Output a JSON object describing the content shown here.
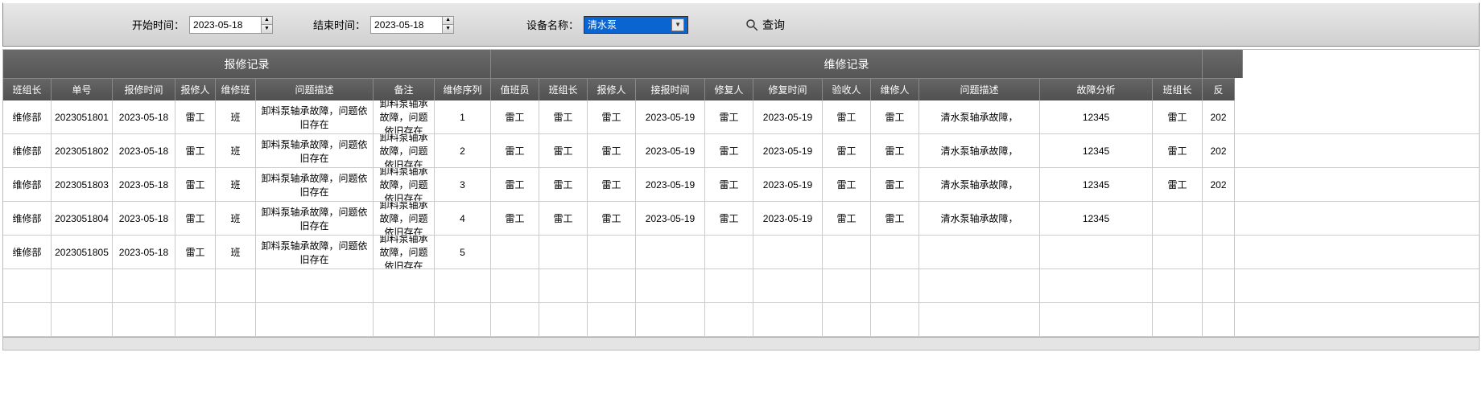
{
  "toolbar": {
    "start_label": "开始时间：",
    "start_date": "2023-05-18",
    "end_label": "结束时间：",
    "end_date": "2023-05-18",
    "device_label": "设备名称：",
    "device_value": "清水泵",
    "search_label": "查询"
  },
  "group_headers": {
    "left": "报修记录",
    "right": "维修记录"
  },
  "columns": [
    "班组长",
    "单号",
    "报修时间",
    "报修人",
    "维修班",
    "问题描述",
    "备注",
    "维修序列",
    "值班员",
    "班组长",
    "报修人",
    "接报时间",
    "修复人",
    "修复时间",
    "验收人",
    "维修人",
    "问题描述",
    "故障分析",
    "班组长",
    "反"
  ],
  "rows": [
    {
      "left": [
        "维修部",
        "2023051801",
        "2023-05-18",
        "雷工",
        "班",
        "卸料泵轴承故障，问题依旧存在",
        "卸料泵轴承故障，问题依旧存在",
        "1"
      ],
      "right": [
        "雷工",
        "雷工",
        "雷工",
        "2023-05-19",
        "雷工",
        "2023-05-19",
        "雷工",
        "雷工",
        "清水泵轴承故障，",
        "12345",
        "雷工",
        "202"
      ]
    },
    {
      "left": [
        "维修部",
        "2023051802",
        "2023-05-18",
        "雷工",
        "班",
        "卸料泵轴承故障，问题依旧存在",
        "卸料泵轴承故障，问题依旧存在",
        "2"
      ],
      "right": [
        "雷工",
        "雷工",
        "雷工",
        "2023-05-19",
        "雷工",
        "2023-05-19",
        "雷工",
        "雷工",
        "清水泵轴承故障，",
        "12345",
        "雷工",
        "202"
      ]
    },
    {
      "left": [
        "维修部",
        "2023051803",
        "2023-05-18",
        "雷工",
        "班",
        "卸料泵轴承故障，问题依旧存在",
        "卸料泵轴承故障，问题依旧存在",
        "3"
      ],
      "right": [
        "雷工",
        "雷工",
        "雷工",
        "2023-05-19",
        "雷工",
        "2023-05-19",
        "雷工",
        "雷工",
        "清水泵轴承故障，",
        "12345",
        "雷工",
        "202"
      ]
    },
    {
      "left": [
        "维修部",
        "2023051804",
        "2023-05-18",
        "雷工",
        "班",
        "卸料泵轴承故障，问题依旧存在",
        "卸料泵轴承故障，问题依旧存在",
        "4"
      ],
      "right": [
        "雷工",
        "雷工",
        "雷工",
        "2023-05-19",
        "雷工",
        "2023-05-19",
        "雷工",
        "雷工",
        "清水泵轴承故障，",
        "12345",
        "",
        ""
      ]
    },
    {
      "left": [
        "维修部",
        "2023051805",
        "2023-05-18",
        "雷工",
        "班",
        "卸料泵轴承故障，问题依旧存在",
        "卸料泵轴承故障，问题依旧存在",
        "5"
      ],
      "right": [
        "",
        "",
        "",
        "",
        "",
        "",
        "",
        "",
        "",
        "",
        "",
        ""
      ]
    }
  ],
  "empty_rows": 2
}
